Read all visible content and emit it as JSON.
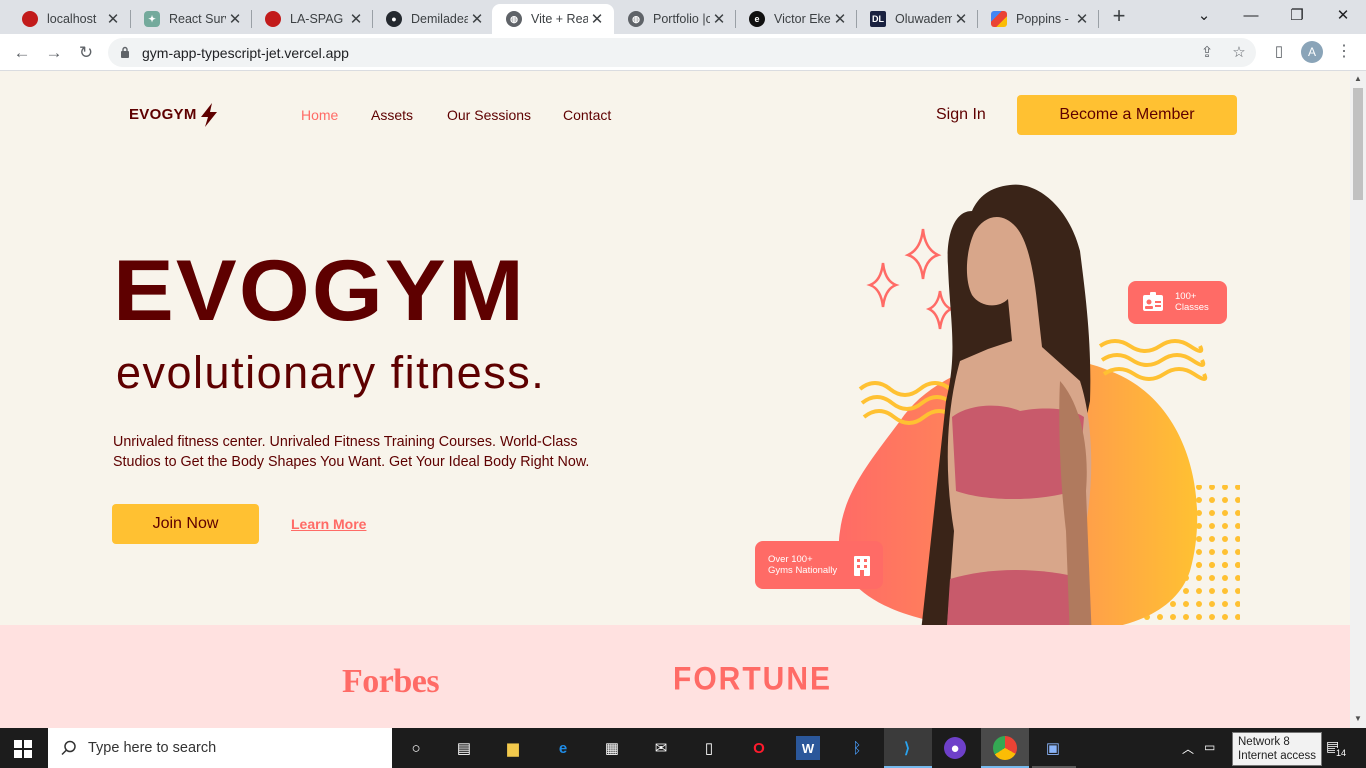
{
  "tabs": [
    {
      "title": "localhost",
      "favicon": "red-circle-icon",
      "active": false
    },
    {
      "title": "React Surv",
      "favicon": "chatgpt-icon",
      "active": false
    },
    {
      "title": "LA-SPAG",
      "favicon": "red-circle-icon",
      "active": false
    },
    {
      "title": "Demiladea",
      "favicon": "github-icon",
      "active": false
    },
    {
      "title": "Vite + Rea",
      "favicon": "globe-icon",
      "active": true
    },
    {
      "title": "Portfolio |c",
      "favicon": "globe-icon",
      "active": false
    },
    {
      "title": "Victor Eke",
      "favicon": "e-icon",
      "active": false
    },
    {
      "title": "Oluwadem",
      "favicon": "dl-icon",
      "active": false
    },
    {
      "title": "Poppins - ",
      "favicon": "google-fonts-icon",
      "active": false
    }
  ],
  "browser": {
    "url": "gym-app-typescript-jet.vercel.app",
    "avatar_letter": "A"
  },
  "site": {
    "logo": "EVOGYM",
    "nav": [
      "Home",
      "Assets",
      "Our Sessions",
      "Contact"
    ],
    "active_nav": "Home",
    "sign_in": "Sign In",
    "member_button": "Become a Member"
  },
  "hero": {
    "title": "EVOGYM",
    "subtitle": "evolutionary fitness.",
    "description": "Unrivaled fitness center. Unrivaled Fitness Training Courses. World-Class Studios to Get the Body Shapes You Want. Get Your Ideal Body Right Now.",
    "join_button": "Join Now",
    "learn_more": "Learn More",
    "badge_classes_line1": "100+",
    "badge_classes_line2": "Classes",
    "badge_gyms_line1": "Over 100+",
    "badge_gyms_line2": "Gyms Nationally"
  },
  "sponsors": [
    "Forbes",
    "FORTUNE"
  ],
  "colors": {
    "primary": "#5e0000",
    "secondary": "#ffc132",
    "accent": "#ff6b66",
    "background": "#f8f4eb",
    "sponsor_band": "#ffe1e0"
  },
  "taskbar": {
    "search_placeholder": "Type here to search",
    "tooltip_line1": "Network 8",
    "tooltip_line2": "Internet access",
    "notification_count": "14"
  }
}
